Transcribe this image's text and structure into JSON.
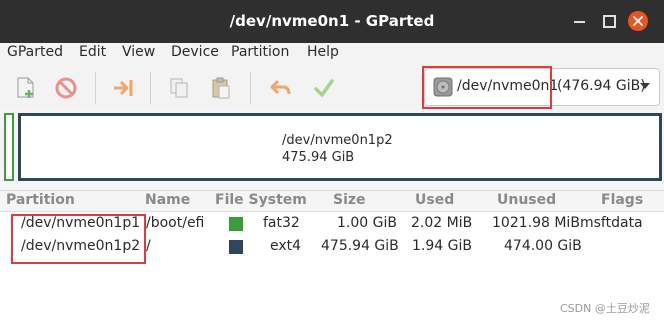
{
  "window": {
    "title": "/dev/nvme0n1 - GParted"
  },
  "menubar": {
    "items": [
      "GParted",
      "Edit",
      "View",
      "Device",
      "Partition",
      "Help"
    ]
  },
  "toolbar": {
    "icons": [
      "new-icon",
      "delete-icon",
      "resize-move-icon",
      "copy-icon",
      "paste-icon",
      "undo-icon",
      "apply-icon"
    ]
  },
  "device_selector": {
    "device": "/dev/nvme0n1",
    "size": "(476.94 GiB)"
  },
  "disk_graph": {
    "partition": "/dev/nvme0n1p2",
    "size": "475.94 GiB"
  },
  "table": {
    "headers": [
      "Partition",
      "Name",
      "File System",
      "Size",
      "Used",
      "Unused",
      "Flags"
    ],
    "rows": [
      {
        "partition": "/dev/nvme0n1p1",
        "name": "/boot/efi",
        "filesystem": "fat32",
        "fs_color": "#3c9d3c",
        "size": "1.00 GiB",
        "used": "2.02 MiB",
        "unused": "1021.98 MiB",
        "flags": "msftdata"
      },
      {
        "partition": "/dev/nvme0n1p2",
        "name": "/",
        "filesystem": "ext4",
        "fs_color": "#30465e",
        "size": "475.94 GiB",
        "used": "1.94 GiB",
        "unused": "474.00 GiB",
        "flags": ""
      }
    ]
  },
  "watermark": "CSDN @土豆炒泥",
  "colors": {
    "highlight": "#e23a3a",
    "fat32": "#3c9d3c",
    "ext4": "#30465e",
    "titlebar": "#2f2f2f"
  }
}
